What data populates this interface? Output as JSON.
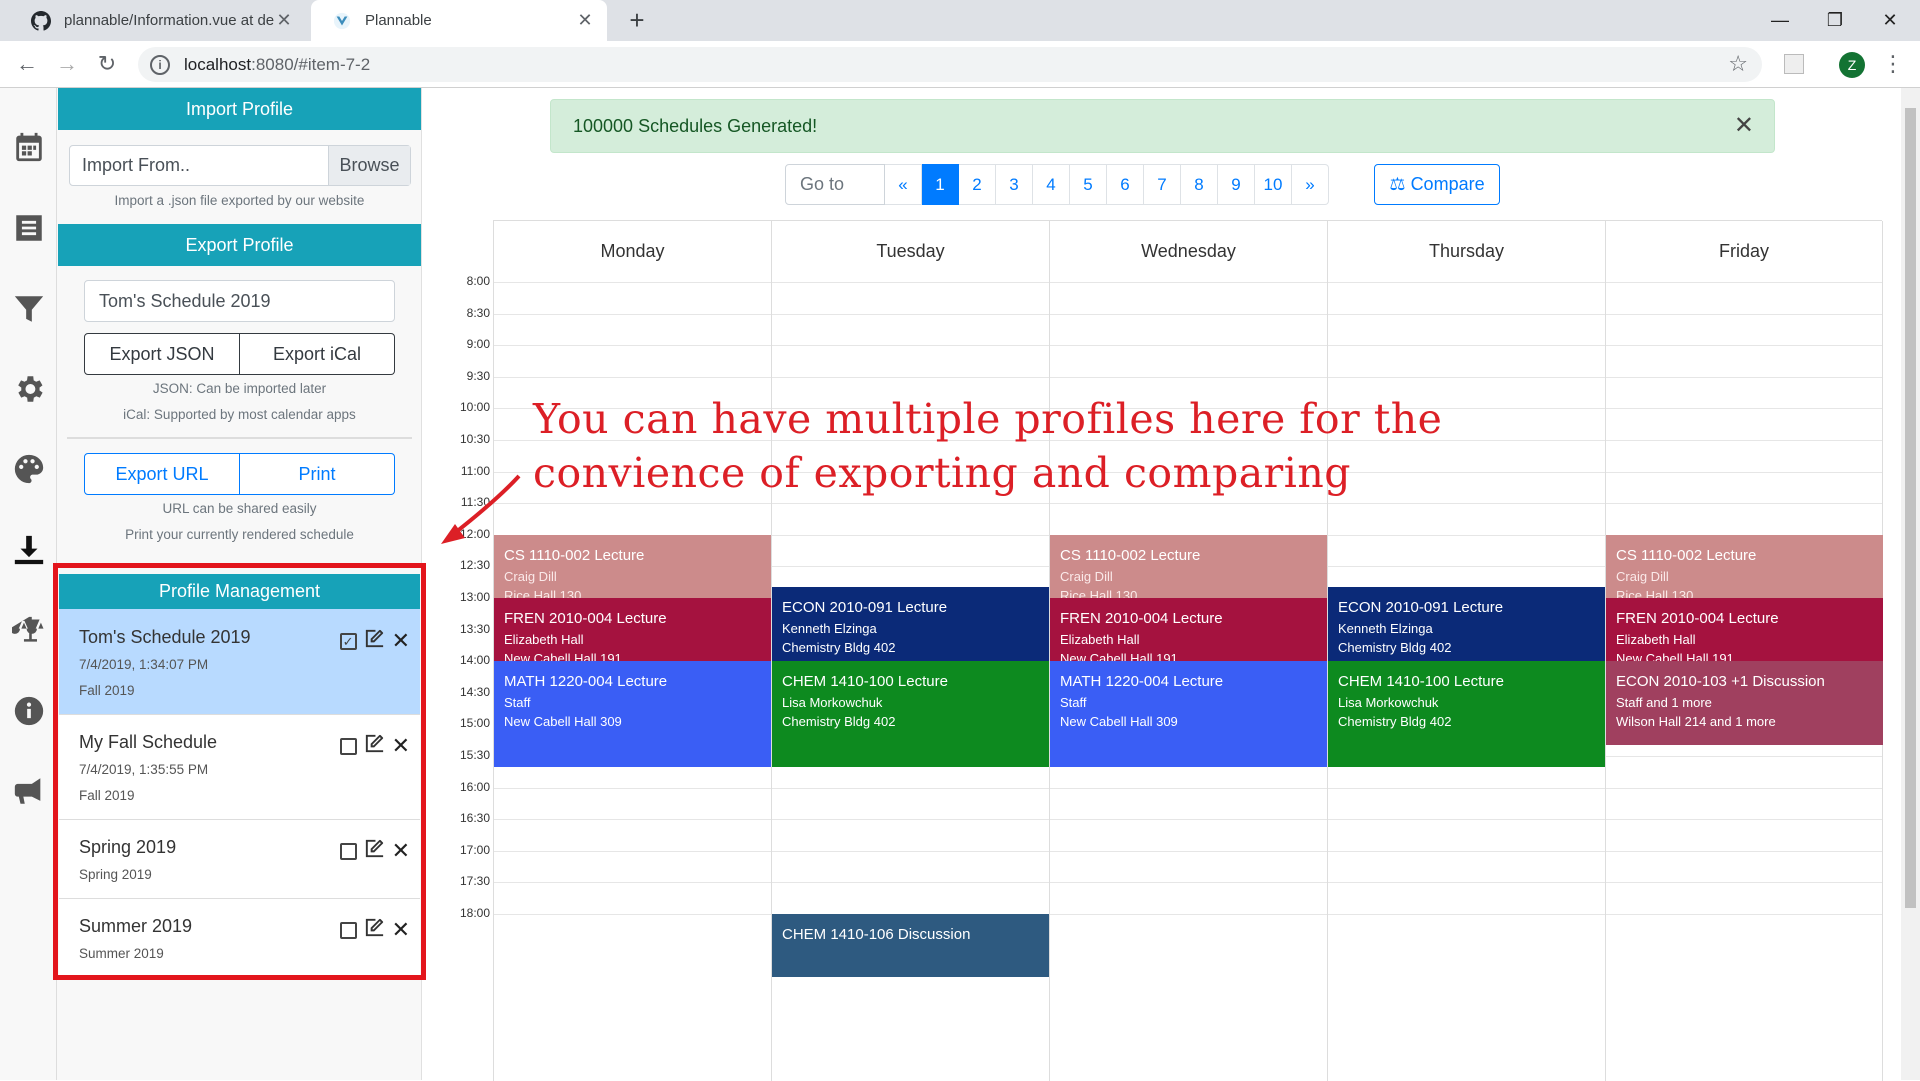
{
  "browser": {
    "tabs": [
      {
        "title": "plannable/Information.vue at de",
        "icon": "github-icon"
      },
      {
        "title": "Plannable",
        "icon": "vue-icon"
      }
    ],
    "url_host": "localhost",
    "url_rest": ":8080/#item-7-2",
    "avatar_letter": "Z"
  },
  "sidebar": {
    "import_header": "Import Profile",
    "import_placeholder": "Import From..",
    "browse_label": "Browse",
    "import_note": "Import a .json file exported by our website",
    "export_header": "Export Profile",
    "profile_name": "Tom's Schedule 2019",
    "export_json": "Export JSON",
    "export_ical": "Export iCal",
    "json_note": "JSON: Can be imported later",
    "ical_note": "iCal: Supported by most calendar apps",
    "export_url": "Export URL",
    "print": "Print",
    "url_note": "URL can be shared easily",
    "print_note": "Print your currently rendered schedule",
    "profile_header": "Profile Management",
    "profiles": [
      {
        "name": "Tom's Schedule 2019",
        "date": "7/4/2019, 1:34:07 PM",
        "term": "Fall 2019",
        "checked": true
      },
      {
        "name": "My Fall Schedule",
        "date": "7/4/2019, 1:35:55 PM",
        "term": "Fall 2019",
        "checked": false
      },
      {
        "name": "Spring 2019",
        "term": "Spring 2019",
        "checked": false
      },
      {
        "name": "Summer 2019",
        "term": "Summer 2019",
        "checked": false
      }
    ]
  },
  "main": {
    "alert": "100000 Schedules Generated!",
    "goto_placeholder": "Go to",
    "pages": [
      "«",
      "1",
      "2",
      "3",
      "4",
      "5",
      "6",
      "7",
      "8",
      "9",
      "10",
      "»"
    ],
    "active_page": "1",
    "compare_label": "Compare",
    "days": [
      "Monday",
      "Tuesday",
      "Wednesday",
      "Thursday",
      "Friday"
    ],
    "times": [
      "8:00",
      "8:30",
      "9:00",
      "9:30",
      "10:00",
      "10:30",
      "11:00",
      "11:30",
      "12:00",
      "12:30",
      "13:00",
      "13:30",
      "14:00",
      "14:30",
      "15:00",
      "15:30",
      "16:00",
      "16:30",
      "17:00",
      "17:30",
      "18:00"
    ],
    "annotation": "You can have multiple profiles here for the\nconvience of exporting and comparing",
    "events": [
      {
        "day": 0,
        "start": "12:00",
        "end": "13:20",
        "title": "CS 1110-002 Lecture",
        "instructor": "Craig Dill",
        "room": "Rice Hall 130",
        "color": "#cc8b8b",
        "kind": "cs"
      },
      {
        "day": 2,
        "start": "12:00",
        "end": "13:20",
        "title": "CS 1110-002 Lecture",
        "instructor": "Craig Dill",
        "room": "Rice Hall 130",
        "color": "#cc8b8b",
        "kind": "cs"
      },
      {
        "day": 4,
        "start": "12:00",
        "end": "13:20",
        "title": "CS 1110-002 Lecture",
        "instructor": "Craig Dill",
        "room": "Rice Hall 130",
        "color": "#cc8b8b",
        "kind": "cs"
      },
      {
        "day": 1,
        "start": "12:50",
        "end": "14:00",
        "title": "ECON 2010-091 Lecture",
        "instructor": "Kenneth Elzinga",
        "room": "Chemistry Bldg 402",
        "color": "#0b2a78",
        "kind": "econ"
      },
      {
        "day": 3,
        "start": "12:50",
        "end": "14:00",
        "title": "ECON 2010-091 Lecture",
        "instructor": "Kenneth Elzinga",
        "room": "Chemistry Bldg 402",
        "color": "#0b2a78",
        "kind": "econ"
      },
      {
        "day": 0,
        "start": "13:00",
        "end": "14:20",
        "title": "FREN 2010-004 Lecture",
        "instructor": "Elizabeth Hall",
        "room": "New Cabell Hall 191",
        "color": "#a5123f",
        "kind": "fren"
      },
      {
        "day": 2,
        "start": "13:00",
        "end": "14:20",
        "title": "FREN 2010-004 Lecture",
        "instructor": "Elizabeth Hall",
        "room": "New Cabell Hall 191",
        "color": "#a5123f",
        "kind": "fren"
      },
      {
        "day": 4,
        "start": "13:00",
        "end": "14:20",
        "title": "FREN 2010-004 Lecture",
        "instructor": "Elizabeth Hall",
        "room": "New Cabell Hall 191",
        "color": "#a5123f",
        "kind": "fren"
      },
      {
        "day": 0,
        "start": "14:00",
        "end": "15:40",
        "title": "MATH 1220-004 Lecture",
        "instructor": "Staff",
        "room": "New Cabell Hall 309",
        "color": "#3a5ef5",
        "kind": "math"
      },
      {
        "day": 2,
        "start": "14:00",
        "end": "15:40",
        "title": "MATH 1220-004 Lecture",
        "instructor": "Staff",
        "room": "New Cabell Hall 309",
        "color": "#3a5ef5",
        "kind": "math"
      },
      {
        "day": 1,
        "start": "14:00",
        "end": "15:40",
        "title": "CHEM 1410-100 Lecture",
        "instructor": "Lisa Morkowchuk",
        "room": "Chemistry Bldg 402",
        "color": "#0d8a1f",
        "kind": "chem"
      },
      {
        "day": 3,
        "start": "14:00",
        "end": "15:40",
        "title": "CHEM 1410-100 Lecture",
        "instructor": "Lisa Morkowchuk",
        "room": "Chemistry Bldg 402",
        "color": "#0d8a1f",
        "kind": "chem"
      },
      {
        "day": 4,
        "start": "14:00",
        "end": "15:20",
        "title": "ECON 2010-103 +1 Discussion",
        "instructor": "Staff and 1 more",
        "room": "Wilson Hall 214 and 1 more",
        "color": "#a0405f",
        "kind": "econd"
      },
      {
        "day": 1,
        "start": "18:00",
        "end": "19:00",
        "title": "CHEM 1410-106 Discussion",
        "instructor": "",
        "room": "",
        "color": "#2e5a80",
        "kind": "chemd"
      }
    ]
  }
}
